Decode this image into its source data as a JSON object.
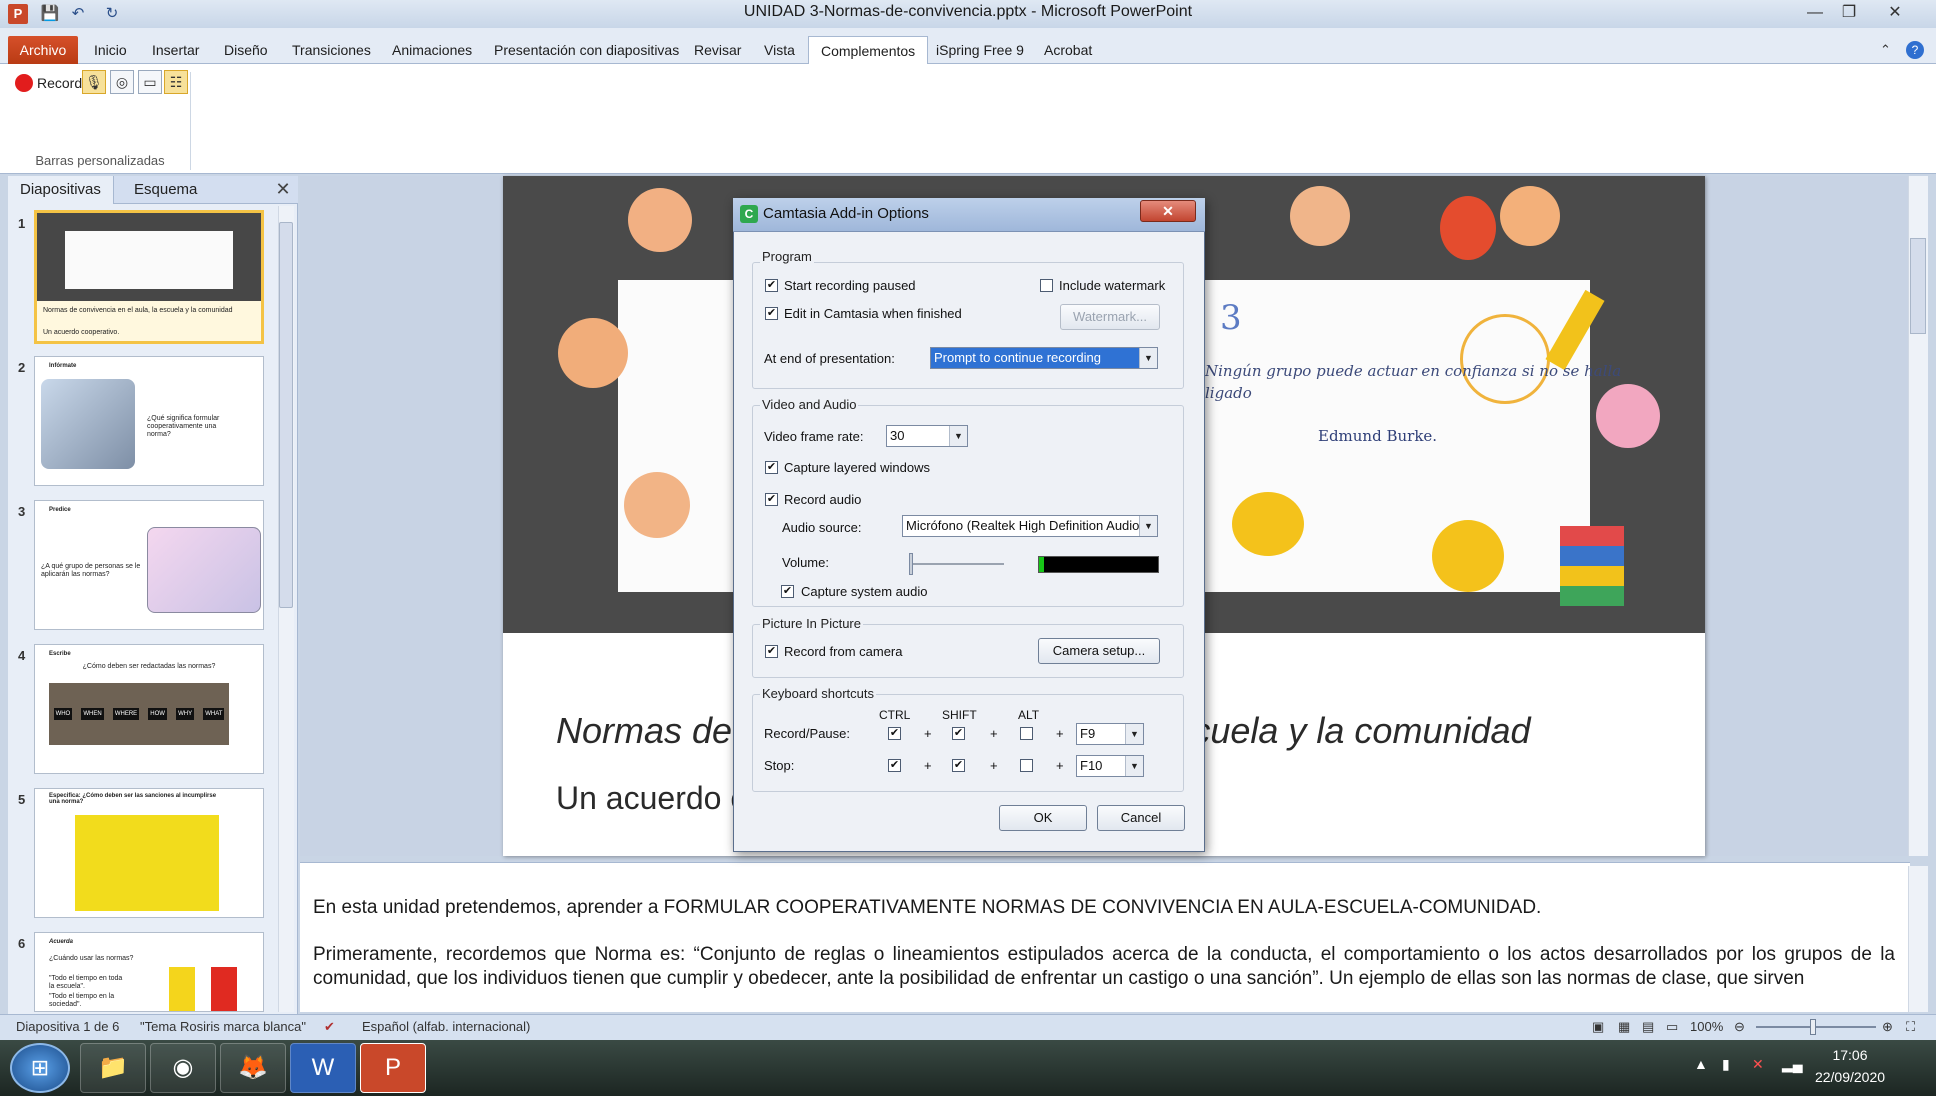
{
  "window": {
    "title": "UNIDAD 3-Normas-de-convivencia.pptx - Microsoft PowerPoint",
    "minimize": "—",
    "restore": "❐",
    "close": "✕"
  },
  "qat": {
    "save": "💾",
    "undo": "↶",
    "redo": "↻"
  },
  "ribbon": {
    "tabs": [
      "Archivo",
      "Inicio",
      "Insertar",
      "Diseño",
      "Transiciones",
      "Animaciones",
      "Presentación con diapositivas",
      "Revisar",
      "Vista",
      "Complementos",
      "iSpring Free 9",
      "Acrobat"
    ],
    "active_tab": "Complementos",
    "record_label": "Record",
    "group_label": "Barras personalizadas"
  },
  "left_pane": {
    "tab_slides": "Diapositivas",
    "tab_outline": "Esquema",
    "close": "✕",
    "thumbs": [
      {
        "num": "1",
        "caption": "Normas de convivencia en el aula, la escuela y la comunidad",
        "caption2": "Un acuerdo cooperativo."
      },
      {
        "num": "2",
        "title": "Infórmate",
        "text": "¿Qué significa formular cooperativamente una norma?"
      },
      {
        "num": "3",
        "title": "Predice",
        "text": "¿A qué grupo de personas se le aplicarán las normas?"
      },
      {
        "num": "4",
        "title": "Escribe",
        "text": "¿Cómo deben ser redactadas las normas?",
        "words": [
          "WHO",
          "WHEN",
          "WHERE",
          "HOW",
          "WHY",
          "WHAT"
        ]
      },
      {
        "num": "5",
        "title": "Especifica: ¿Cómo deben ser las sanciones al incumplirse una norma?"
      },
      {
        "num": "6",
        "title": "Acuerda",
        "text": "¿Cuándo usar las normas?",
        "bullets": [
          "\"Todo el tiempo en toda la escuela\".",
          "\"Todo el tiempo en la sociedad\"."
        ]
      }
    ]
  },
  "slide": {
    "quote": "Ningún grupo puede actuar en confianza si no se halla ligado",
    "author": "Edmund Burke.",
    "number_glyph": "3",
    "title": "Normas de convivencia en el aula, la escuela y la comunidad",
    "subtitle": "Un acuerdo cooperativo."
  },
  "notes": {
    "p1": "En esta unidad pretendemos,  aprender a FORMULAR COOPERATIVAMENTE NORMAS DE CONVIVENCIA EN AULA-ESCUELA-COMUNIDAD.",
    "p2": "Primeramente, recordemos que Norma es: “Conjunto de reglas o lineamientos estipulados acerca de la conducta, el comportamiento o los actos desarrollados por los grupos de la comunidad, que los individuos tienen que cumplir y obedecer, ante la posibilidad de enfrentar un castigo o una sanción”. Un ejemplo de ellas son las normas de clase, que sirven"
  },
  "status": {
    "slide_counter": "Diapositiva 1 de 6",
    "theme": "\"Tema Rosiris marca blanca\"",
    "language": "Español (alfab. internacional)",
    "zoom": "100%"
  },
  "taskbar": {
    "apps": [
      "📁",
      "◉",
      "🦊",
      "W",
      "P"
    ],
    "time": "17:06",
    "date": "22/09/2020"
  },
  "dialog": {
    "title": "Camtasia Add-in Options",
    "icon": "C",
    "close": "✕",
    "program": {
      "legend": "Program",
      "start_paused": {
        "label": "Start recording paused",
        "checked": true
      },
      "edit_in_camtasia": {
        "label": "Edit in Camtasia when finished",
        "checked": true
      },
      "include_watermark": {
        "label": "Include watermark",
        "checked": false
      },
      "watermark_button": "Watermark...",
      "end_label": "At end of presentation:",
      "end_value": "Prompt to continue recording"
    },
    "video_audio": {
      "legend": "Video and Audio",
      "frame_rate_label": "Video frame rate:",
      "frame_rate_value": "30",
      "capture_layered": {
        "label": "Capture layered windows",
        "checked": true
      },
      "record_audio": {
        "label": "Record audio",
        "checked": true
      },
      "audio_source_label": "Audio source:",
      "audio_source_value": "Micrófono (Realtek High Definition Audio)",
      "volume_label": "Volume:",
      "volume_level": 0,
      "capture_system_audio": {
        "label": "Capture system audio",
        "checked": true
      }
    },
    "pip": {
      "legend": "Picture In Picture",
      "record_camera": {
        "label": "Record from camera",
        "checked": true
      },
      "camera_setup": "Camera setup..."
    },
    "shortcuts": {
      "legend": "Keyboard shortcuts",
      "col_ctrl": "CTRL",
      "col_shift": "SHIFT",
      "col_alt": "ALT",
      "plus": "+",
      "rows": [
        {
          "label": "Record/Pause:",
          "ctrl": true,
          "shift": true,
          "alt": false,
          "key": "F9"
        },
        {
          "label": "Stop:",
          "ctrl": true,
          "shift": true,
          "alt": false,
          "key": "F10"
        }
      ]
    },
    "ok": "OK",
    "cancel": "Cancel"
  }
}
